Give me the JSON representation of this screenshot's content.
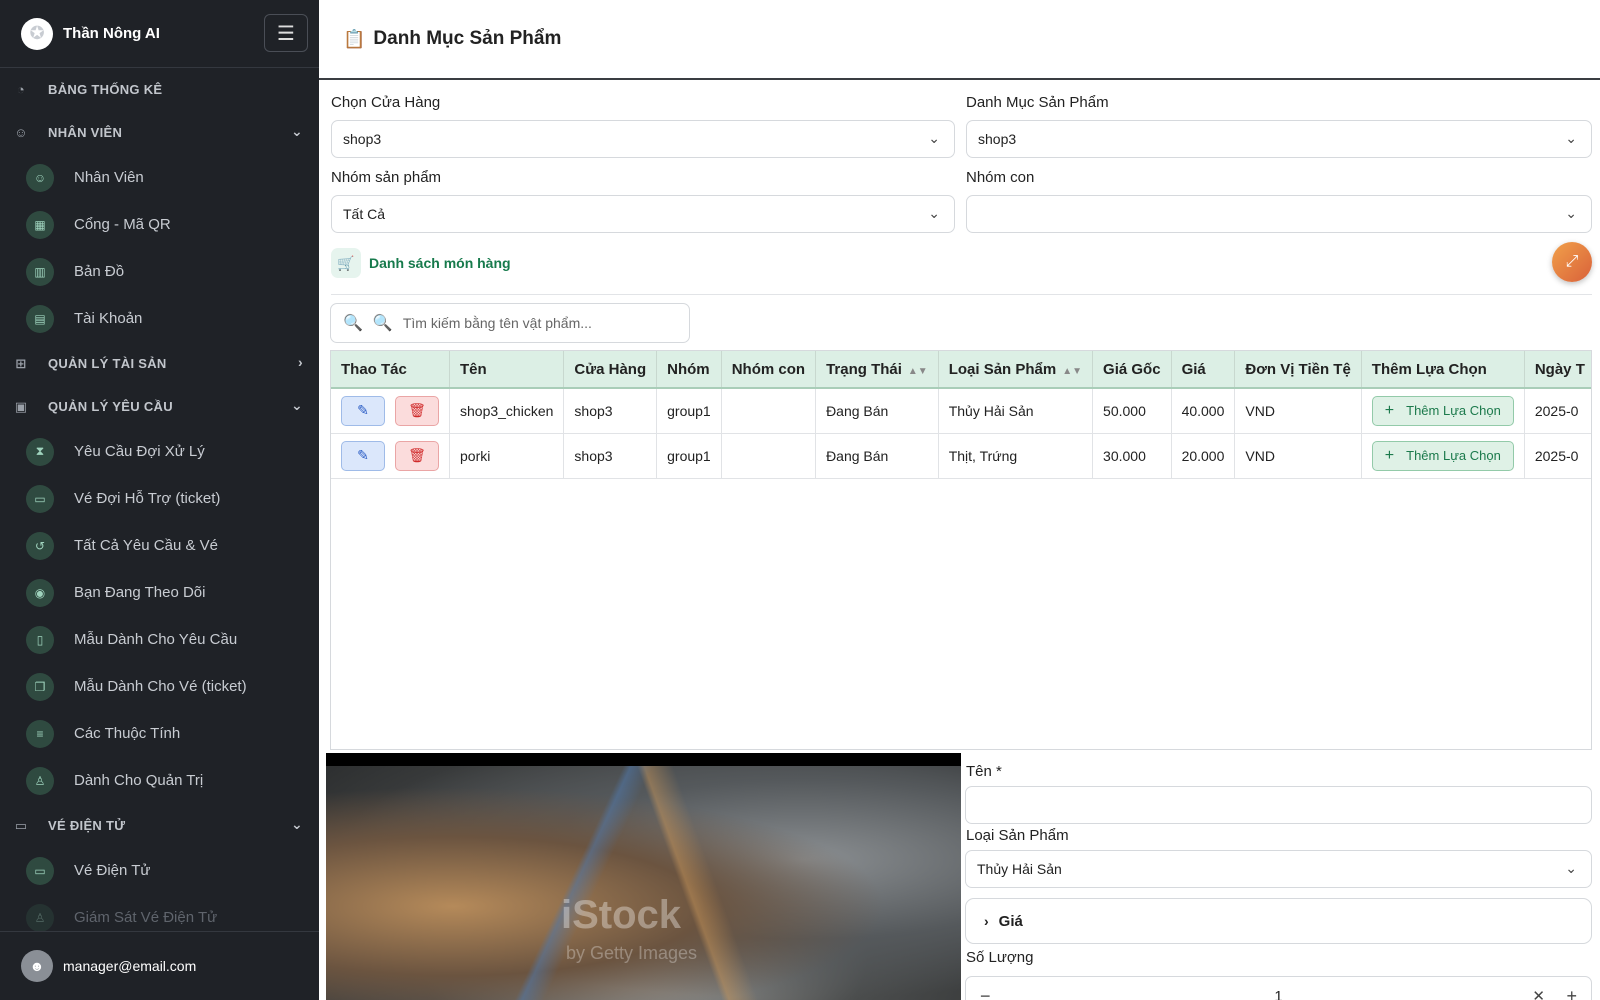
{
  "brand": {
    "name": "Thần Nông AI"
  },
  "sidebar": {
    "sections": [
      {
        "label": "BẢNG THỐNG KÊ"
      },
      {
        "label": "NHÂN VIÊN",
        "items": [
          "Nhân Viên",
          "Cổng - Mã QR",
          "Bản Đồ",
          "Tài Khoản"
        ]
      },
      {
        "label": "QUẢN LÝ TÀI SẢN"
      },
      {
        "label": "QUẢN LÝ YÊU CẦU",
        "items": [
          "Yêu Cầu Đợi Xử Lý",
          "Vé Đợi Hỗ Trợ (ticket)",
          "Tất Cả Yêu Cầu & Vé",
          "Bạn Đang Theo Dõi",
          "Mẫu Dành Cho Yêu Cầu",
          "Mẫu Dành Cho Vé (ticket)",
          "Các Thuộc Tính",
          "Dành Cho Quản Trị"
        ]
      },
      {
        "label": "VÉ ĐIỆN TỬ",
        "items": [
          "Vé Điện Tử",
          "Giám Sát Vé Điện Tử"
        ]
      }
    ],
    "user_email": "manager@email.com"
  },
  "page": {
    "title": "Danh Mục Sản Phẩm"
  },
  "filters": {
    "store_label": "Chọn Cửa Hàng",
    "store_value": "shop3",
    "category_label": "Danh Mục Sản Phẩm",
    "category_value": "shop3",
    "group_label": "Nhóm sản phẩm",
    "group_value": "Tất Cả",
    "subgroup_label": "Nhóm con",
    "subgroup_value": ""
  },
  "list": {
    "title": "Danh sách món hàng",
    "search_placeholder": "Tìm kiếm bằng tên vật phẩm..."
  },
  "table": {
    "headers": [
      "Thao Tác",
      "Tên",
      "Cửa Hàng",
      "Nhóm",
      "Nhóm con",
      "Trạng Thái",
      "Loại Sản Phẩm",
      "Giá Gốc",
      "Giá",
      "Đơn Vị Tiền Tệ",
      "Thêm Lựa Chọn",
      "Ngày T"
    ],
    "add_option_label": "Thêm Lựa Chọn",
    "rows": [
      {
        "name": "shop3_chicken",
        "store": "shop3",
        "group": "group1",
        "subgroup": "",
        "status": "Đang Bán",
        "type": "Thủy Hải Sản",
        "original_price": "50.000",
        "price": "40.000",
        "currency": "VND",
        "date": "2025-0"
      },
      {
        "name": "porki",
        "store": "shop3",
        "group": "group1",
        "subgroup": "",
        "status": "Đang Bán",
        "type": "Thịt, Trứng",
        "original_price": "30.000",
        "price": "20.000",
        "currency": "VND",
        "date": "2025-0"
      }
    ]
  },
  "image": {
    "watermark": "iStock",
    "watermark_sub": "by Getty Images"
  },
  "form": {
    "name_label": "Tên *",
    "name_value": "",
    "type_label": "Loại Sản Phẩm",
    "type_value": "Thủy Hải Sản",
    "price_section": "Giá",
    "quantity_label": "Số Lượng",
    "quantity_value": "1"
  },
  "colors": {
    "sidebar_bg": "#1f2227",
    "header_green": "#dcefe5",
    "accent_green": "#177a4c",
    "edit_blue": "#2a5cc4",
    "delete_red": "#d02a2a"
  }
}
